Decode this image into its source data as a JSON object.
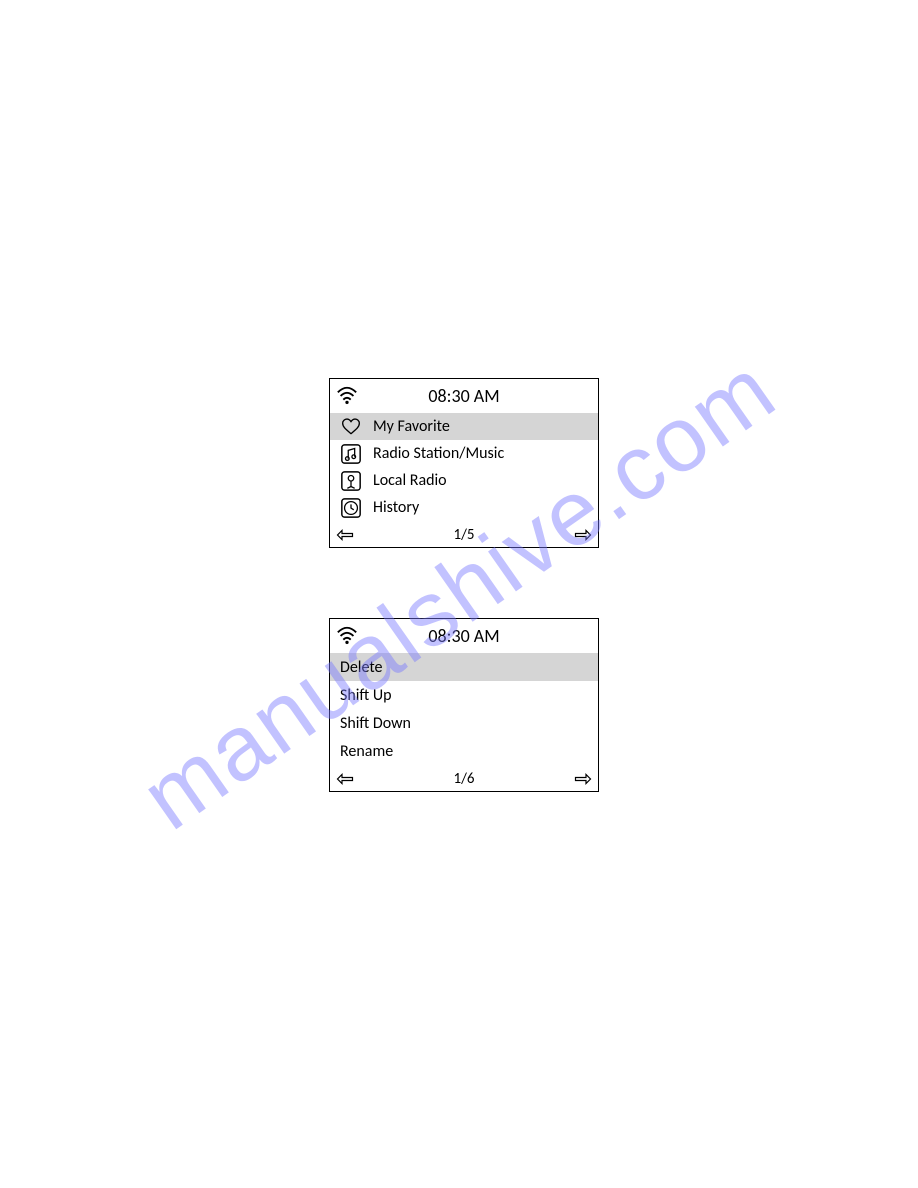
{
  "watermark": "manualshive.com",
  "screen1": {
    "time": "08:30 AM",
    "items": [
      {
        "label": "My Favorite",
        "icon": "heart",
        "selected": true
      },
      {
        "label": "Radio Station/Music",
        "icon": "music",
        "selected": false
      },
      {
        "label": "Local Radio",
        "icon": "antenna",
        "selected": false
      },
      {
        "label": "History",
        "icon": "clock",
        "selected": false
      }
    ],
    "page": "1/5"
  },
  "screen2": {
    "time": "08:30 AM",
    "items": [
      {
        "label": "Delete",
        "selected": true
      },
      {
        "label": "Shift Up",
        "selected": false
      },
      {
        "label": "Shift Down",
        "selected": false
      },
      {
        "label": "Rename",
        "selected": false
      }
    ],
    "page": "1/6"
  }
}
